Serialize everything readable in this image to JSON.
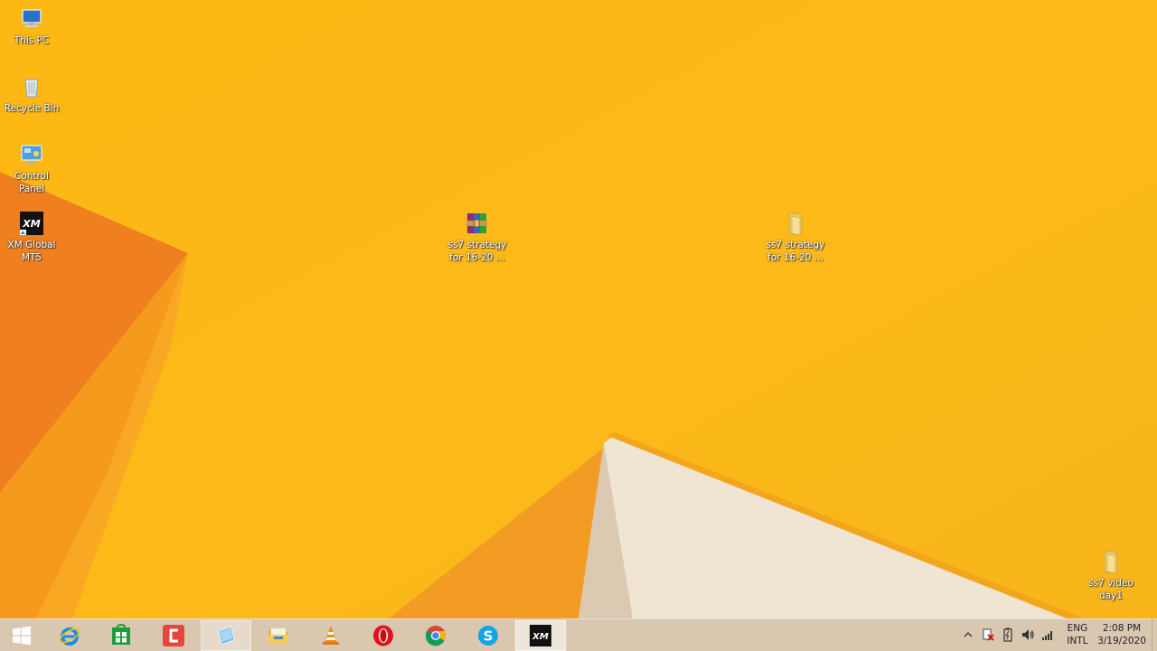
{
  "desktop": {
    "icons": [
      {
        "name": "this-pc",
        "label": "This PC",
        "icon": "computer-icon"
      },
      {
        "name": "recycle-bin",
        "label": "Recycle Bin",
        "icon": "recycle-bin-icon"
      },
      {
        "name": "control-panel",
        "label": "Control\nPanel",
        "icon": "control-panel-icon"
      },
      {
        "name": "xm-global-mt5",
        "label": "XM Global\nMT5",
        "icon": "xm-logo-icon"
      },
      {
        "name": "ss7-strategy-archive",
        "label": "ss7 strategy\nfor 16-20 ...",
        "icon": "winrar-archive-icon"
      },
      {
        "name": "ss7-strategy-folder",
        "label": "ss7 strategy\nfor 16-20 ...",
        "icon": "folder-icon"
      },
      {
        "name": "ss7-video-day1",
        "label": "ss7 video\nday1",
        "icon": "folder-icon"
      }
    ]
  },
  "taskbar": {
    "pinned": [
      {
        "name": "start",
        "icon": "windows-logo-icon"
      },
      {
        "name": "internet-explorer",
        "icon": "internet-explorer-icon"
      },
      {
        "name": "store",
        "icon": "store-icon"
      },
      {
        "name": "camtasia",
        "icon": "camtasia-icon"
      },
      {
        "name": "app-light-blue",
        "icon": "tablet-app-icon"
      },
      {
        "name": "file-explorer",
        "icon": "file-explorer-icon"
      },
      {
        "name": "vlc",
        "icon": "vlc-cone-icon"
      },
      {
        "name": "opera",
        "icon": "opera-icon"
      },
      {
        "name": "chrome",
        "icon": "chrome-icon"
      },
      {
        "name": "skype",
        "icon": "skype-icon"
      },
      {
        "name": "xm-mt5",
        "icon": "xm-logo-icon"
      }
    ],
    "tray": {
      "icons": [
        "show-hidden-icons-icon",
        "action-center-icon",
        "battery-icon",
        "volume-icon",
        "network-signal-icon"
      ],
      "language_top": "ENG",
      "language_bottom": "INTL",
      "time": "2:08 PM",
      "date": "3/19/2020"
    }
  },
  "colors": {
    "wallpaper_base": "#fbb716",
    "wallpaper_orange": "#f08a1e",
    "wallpaper_white": "#f3e7d6"
  }
}
